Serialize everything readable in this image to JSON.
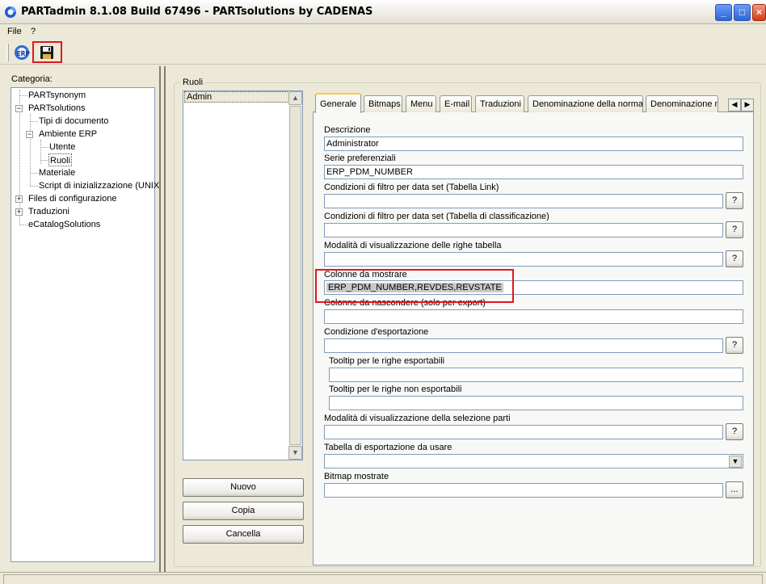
{
  "window": {
    "title": "PARTadmin 8.1.08 Build 67496 - PARTsolutions by CADENAS",
    "controls": [
      "minimize",
      "maximize",
      "close"
    ]
  },
  "menu": [
    "File",
    "?"
  ],
  "toolbar": {
    "erp_button_icon": "erp-icon",
    "save_button_icon": "floppy-disk-icon"
  },
  "sidebar": {
    "label": "Categoria:",
    "tree": [
      {
        "label": "PARTsynonym",
        "level": 0,
        "expander": ""
      },
      {
        "label": "PARTsolutions",
        "level": 0,
        "expander": "minus"
      },
      {
        "label": "Tipi di documento",
        "level": 1,
        "expander": ""
      },
      {
        "label": "Ambiente ERP",
        "level": 1,
        "expander": "minus"
      },
      {
        "label": "Utente",
        "level": 2,
        "expander": ""
      },
      {
        "label": "Ruoli",
        "level": 2,
        "expander": "",
        "selected": true
      },
      {
        "label": "Materiale",
        "level": 1,
        "expander": ""
      },
      {
        "label": "Script di inizializzazione (UNIX",
        "level": 1,
        "expander": ""
      },
      {
        "label": "Files di configurazione",
        "level": 0,
        "expander": "plus"
      },
      {
        "label": "Traduzioni",
        "level": 0,
        "expander": "plus"
      },
      {
        "label": "eCatalogSolutions",
        "level": 0,
        "expander": ""
      }
    ]
  },
  "roles": {
    "group_label": "Ruoli",
    "items": [
      "Admin"
    ],
    "buttons": {
      "new": "Nuovo",
      "copy": "Copia",
      "delete": "Cancella"
    }
  },
  "tabs": [
    "Generale",
    "Bitmaps",
    "Menu",
    "E-mail",
    "Traduzioni",
    "Denominazione della norma",
    "Denominazione n"
  ],
  "active_tab": "Generale",
  "form": {
    "descrizione": {
      "label": "Descrizione",
      "value": "Administrator"
    },
    "serie": {
      "label": "Serie preferenziali",
      "value": "ERP_PDM_NUMBER"
    },
    "filtro_link": {
      "label": "Condizioni di filtro per data set (Tabella Link)",
      "value": "",
      "button": "?"
    },
    "filtro_class": {
      "label": "Condizioni di filtro per data set (Tabella di classificazione)",
      "value": "",
      "button": "?"
    },
    "modalita_righe": {
      "label": "Modalità di visualizzazione delle righe tabella",
      "value": "",
      "button": "?"
    },
    "colonne_mostrare": {
      "label": "Colonne da mostrare",
      "value": "ERP_PDM_NUMBER,REVDES,REVSTATE"
    },
    "colonne_nascondere": {
      "label": "Colonne da nascondere (solo per export)",
      "value": ""
    },
    "condizione_esportazione": {
      "label": "Condizione d'esportazione",
      "value": "",
      "button": "?"
    },
    "tooltip_esportabili": {
      "label": "Tooltip per le righe esportabili",
      "value": ""
    },
    "tooltip_non_esportabili": {
      "label": "Tooltip per le righe non esportabili",
      "value": ""
    },
    "modalita_selezione": {
      "label": "Modalità di visualizzazione della selezione parti",
      "value": "",
      "button": "?"
    },
    "tabella_esportazione": {
      "label": "Tabella di esportazione da usare",
      "value": ""
    },
    "bitmap": {
      "label": "Bitmap mostrate",
      "value": "",
      "button": "..."
    }
  },
  "highlight_color": "#e3161f"
}
